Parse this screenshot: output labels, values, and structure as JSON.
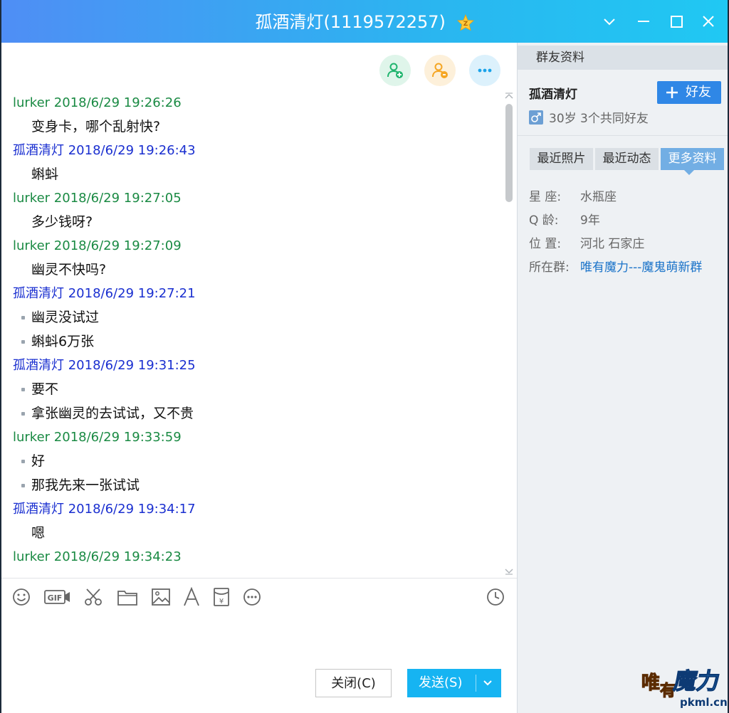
{
  "window": {
    "title": "孤酒清灯(1119572257)",
    "controls": [
      "chevron-down-icon",
      "minimize-icon",
      "maximize-icon",
      "close-icon"
    ]
  },
  "actions": [
    {
      "name": "add-member-button",
      "icon": "add-person-icon",
      "color": "#20b46e"
    },
    {
      "name": "member-settings-button",
      "icon": "person-settings-icon",
      "color": "#f5a623"
    },
    {
      "name": "more-options-button",
      "icon": "more-icon",
      "color": "#1aa3ea"
    }
  ],
  "messages": [
    {
      "sender": "lurker",
      "time": "2018/6/29 19:26:26",
      "type": "self",
      "lines": [
        "变身卡，哪个乱射快?"
      ],
      "bullet": false
    },
    {
      "sender": "孤酒清灯",
      "time": "2018/6/29 19:26:43",
      "type": "peer",
      "lines": [
        "蝌蚪"
      ],
      "bullet": false
    },
    {
      "sender": "lurker",
      "time": "2018/6/29 19:27:05",
      "type": "self",
      "lines": [
        "多少钱呀?"
      ],
      "bullet": false
    },
    {
      "sender": "lurker",
      "time": "2018/6/29 19:27:09",
      "type": "self",
      "lines": [
        "幽灵不快吗?"
      ],
      "bullet": false
    },
    {
      "sender": "孤酒清灯",
      "time": "2018/6/29 19:27:21",
      "type": "peer",
      "lines": [
        "幽灵没试过",
        "蝌蚪6万张"
      ],
      "bullet": true
    },
    {
      "sender": "孤酒清灯",
      "time": "2018/6/29 19:31:25",
      "type": "peer",
      "lines": [
        "要不",
        "拿张幽灵的去试试，又不贵"
      ],
      "bullet": true
    },
    {
      "sender": "lurker",
      "time": "2018/6/29 19:33:59",
      "type": "self",
      "lines": [
        "好",
        "那我先来一张试试"
      ],
      "bullet": true
    },
    {
      "sender": "孤酒清灯",
      "time": "2018/6/29 19:34:17",
      "type": "peer",
      "lines": [
        "嗯"
      ],
      "bullet": false
    },
    {
      "sender": "lurker",
      "time": "2018/6/29 19:34:23",
      "type": "self",
      "lines": [],
      "bullet": false
    }
  ],
  "toolbar": {
    "icons": [
      "emoji-icon",
      "gif-icon",
      "screenshot-scissors-icon",
      "folder-icon",
      "image-icon",
      "font-icon",
      "red-packet-icon",
      "more-icon",
      "history-clock-icon"
    ]
  },
  "buttons": {
    "close_label": "关闭(C)",
    "send_label": "发送(S)"
  },
  "side": {
    "header": "群友资料",
    "name": "孤酒清灯",
    "add_friend": "好友",
    "info": "30岁 3个共同好友",
    "tabs": [
      "最近照片",
      "最近动态",
      "更多资料"
    ],
    "active_tab": 2,
    "details": [
      {
        "label": "星    座:",
        "value": "水瓶座",
        "link": false
      },
      {
        "label": "Q    龄:",
        "value": "9年",
        "link": false
      },
      {
        "label": "位    置:",
        "value": "河北 石家庄",
        "link": false
      },
      {
        "label": "所在群:",
        "value": "唯有魔力---魔鬼萌新群",
        "link": true
      }
    ]
  },
  "watermark": {
    "text": "唯有魔力",
    "url": "pkml.cn"
  }
}
